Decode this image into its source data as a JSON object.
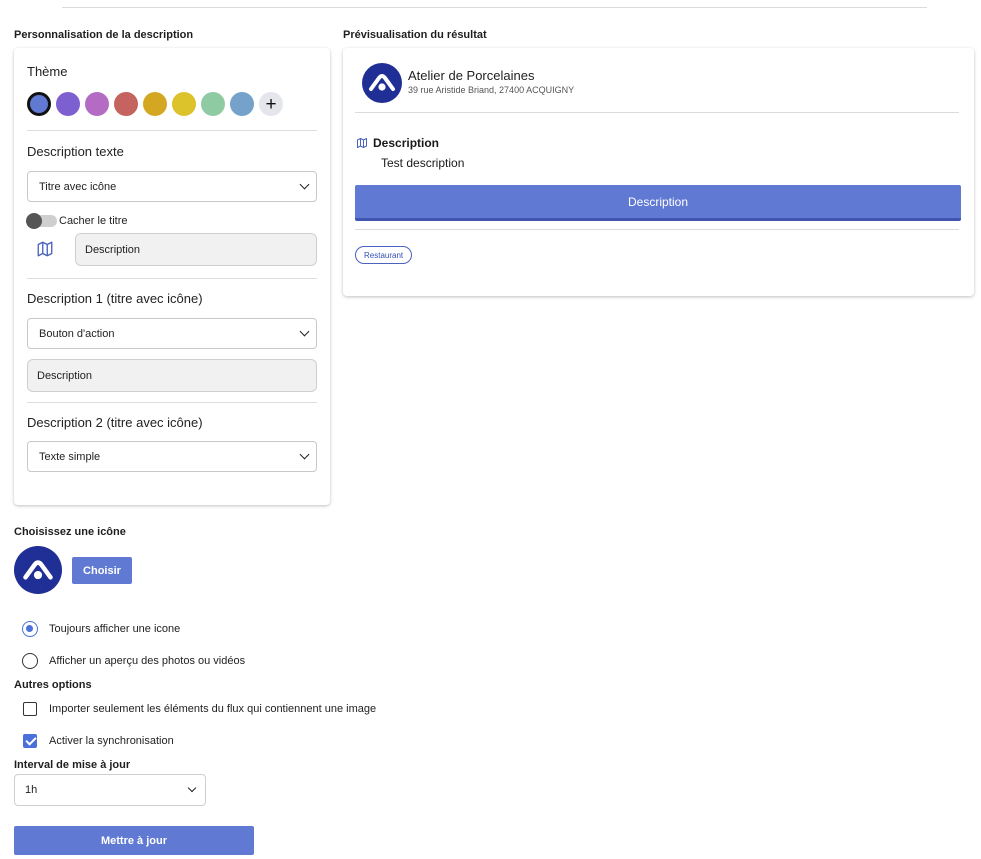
{
  "left_section_title": "Personnalisation de la description",
  "preview_section_title": "Prévisualisation du résultat",
  "theme": {
    "label": "Thème",
    "swatches": [
      "#6079d3",
      "#7e5fd0",
      "#b36bc4",
      "#c4635f",
      "#d4a723",
      "#dcc22b",
      "#8ecba3",
      "#74a2cb"
    ],
    "selected_index": 0,
    "add_label": "+"
  },
  "description_text": {
    "label": "Description texte",
    "select_value": "Titre avec icône",
    "toggle_label": "Cacher le titre",
    "toggle_on": false,
    "icon": "map-icon",
    "input_value": "Description"
  },
  "description_1": {
    "label": "Description 1 (titre avec icône)",
    "select_value": "Bouton d'action",
    "input_value": "Description"
  },
  "description_2": {
    "label": "Description 2 (titre avec icône)",
    "select_value": "Texte simple"
  },
  "preview": {
    "name": "Atelier de Porcelaines",
    "address": "39 rue Aristide Briand, 27400 ACQUIGNY",
    "desc_title": "Description",
    "desc_text": "Test description",
    "button_label": "Description",
    "tag": "Restaurant",
    "logo_color": "#1f2f95",
    "accent_color": "#6079d3"
  },
  "icon_chooser": {
    "title": "Choisissez une icône",
    "button_label": "Choisir"
  },
  "display_options": [
    {
      "label": "Toujours afficher une icone",
      "checked": true
    },
    {
      "label": "Afficher un aperçu des photos ou vidéos",
      "checked": false
    }
  ],
  "other_options": {
    "title": "Autres options",
    "items": [
      {
        "label": "Importer seulement les éléments du flux qui contiennent une image",
        "checked": false
      },
      {
        "label": "Activer la synchronisation",
        "checked": true
      }
    ]
  },
  "interval": {
    "label": "Interval de mise à jour",
    "value": "1h"
  },
  "update_button": "Mettre à jour"
}
